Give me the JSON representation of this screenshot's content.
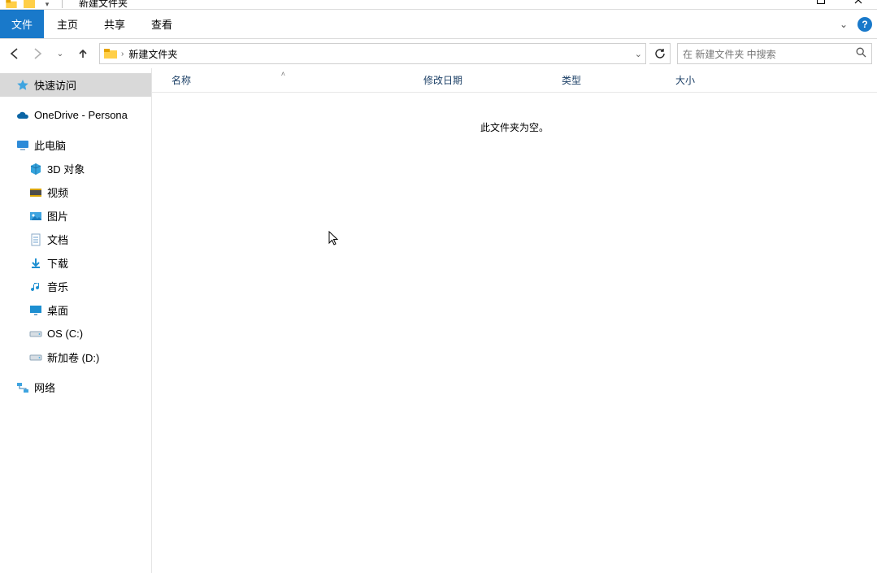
{
  "window": {
    "title": "新建文件夹"
  },
  "ribbon": {
    "file": "文件",
    "tabs": [
      "主页",
      "共享",
      "查看"
    ]
  },
  "nav": {
    "refresh_tooltip": "刷新"
  },
  "breadcrumb": {
    "current": "新建文件夹"
  },
  "search": {
    "placeholder": "在 新建文件夹 中搜索"
  },
  "tree": {
    "quick_access": "快速访问",
    "onedrive": "OneDrive - Persona",
    "this_pc": "此电脑",
    "items": [
      {
        "label": "3D 对象",
        "icon": "cube"
      },
      {
        "label": "视频",
        "icon": "video"
      },
      {
        "label": "图片",
        "icon": "pictures"
      },
      {
        "label": "文档",
        "icon": "documents"
      },
      {
        "label": "下载",
        "icon": "downloads"
      },
      {
        "label": "音乐",
        "icon": "music"
      },
      {
        "label": "桌面",
        "icon": "desktop"
      },
      {
        "label": "OS (C:)",
        "icon": "drive"
      },
      {
        "label": "新加卷 (D:)",
        "icon": "drive"
      }
    ],
    "network": "网络"
  },
  "columns": {
    "name": "名称",
    "date": "修改日期",
    "type": "类型",
    "size": "大小"
  },
  "content": {
    "empty_text": "此文件夹为空。"
  }
}
